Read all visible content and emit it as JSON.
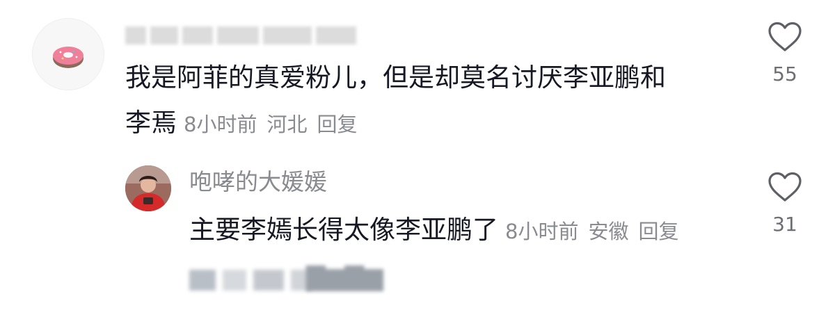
{
  "comment": {
    "text_line1": "我是阿菲的真爱粉儿，但是却莫名讨厌李亚鹏和",
    "text_line2": "李焉",
    "time": "8小时前",
    "location": "河北",
    "reply_label": "回复",
    "likes": "55",
    "avatar_icon": "donut-icon"
  },
  "reply": {
    "username": "咆哮的大媛媛",
    "text": "主要李嫣长得太像李亚鹏了",
    "time": "8小时前",
    "location": "安徽",
    "reply_label": "回复",
    "likes": "31"
  },
  "colors": {
    "primary_text": "#161823",
    "secondary_text": "#8a8b91",
    "heart_stroke": "#5f6066"
  }
}
